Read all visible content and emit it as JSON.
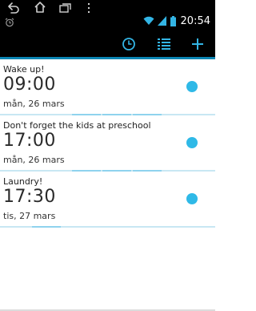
{
  "status_bar": {
    "time": "20:54",
    "icons": [
      "home-icon",
      "back-icon",
      "recent-apps-icon",
      "menu-dots-icon",
      "alarm-clock-icon",
      "wifi-icon",
      "signal-icon",
      "battery-icon"
    ]
  },
  "action_bar": {
    "buttons": [
      "clock-icon",
      "list-icon",
      "add-icon"
    ],
    "accent": "#0a85b3"
  },
  "alarms": [
    {
      "label": "Wake up!",
      "time": "09:00",
      "date": "mån, 26 mars",
      "enabled": true
    },
    {
      "label": "Don't forget the kids at preschool",
      "time": "17:00",
      "date": "mån, 26 mars",
      "enabled": true
    },
    {
      "label": "Laundry!",
      "time": "17:30",
      "date": "tis, 27 mars",
      "enabled": true
    }
  ],
  "colors": {
    "enabled_dot": "#2fb9e7",
    "divider": "#c8e7f3"
  }
}
